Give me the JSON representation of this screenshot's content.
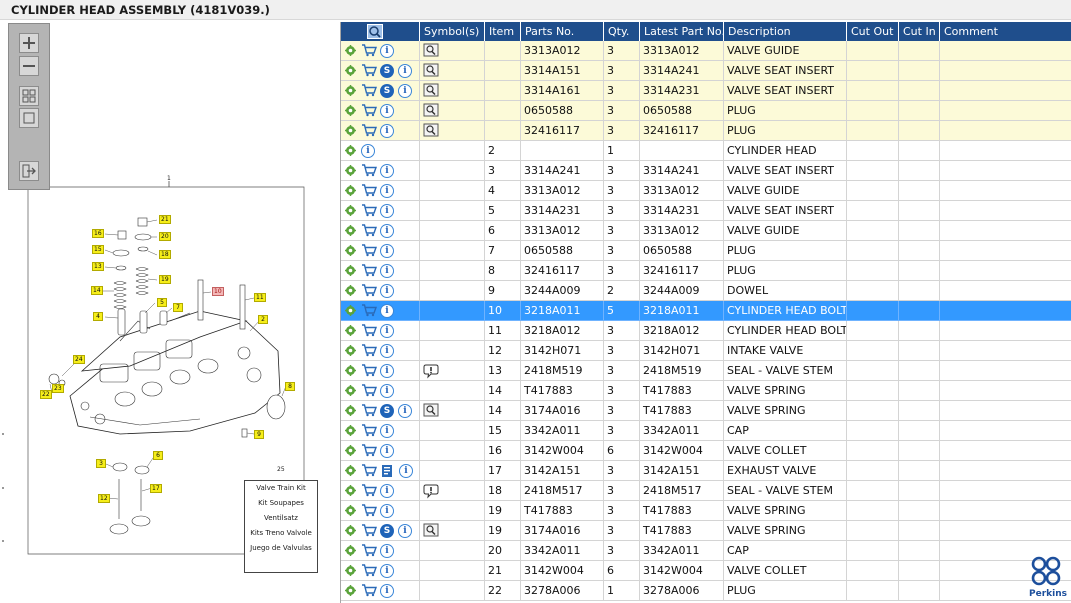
{
  "title": "CYLINDER HEAD ASSEMBLY (4181V039.)",
  "toolbar": {
    "buttons": [
      {
        "icon": "zoom-in-icon"
      },
      {
        "icon": "zoom-out-icon"
      },
      {
        "icon": "fit-all-icon"
      },
      {
        "icon": "fit-page-icon"
      },
      {
        "icon": "export-icon"
      }
    ]
  },
  "drawing": {
    "assembly_number": "1",
    "kit_number": "25",
    "kit_legend": [
      "Valve Train Kit",
      "Kit Soupapes",
      "Ventilsatz",
      "Kits Treno Valvole",
      "Juego de Valvulas"
    ],
    "callouts": [
      "21",
      "16",
      "20",
      "15",
      "18",
      "13",
      "19",
      "14",
      "5",
      "7",
      "10",
      "11",
      "4",
      "2",
      "24",
      "23",
      "22",
      "8",
      "9",
      "3",
      "6",
      "12",
      "17"
    ]
  },
  "columns": [
    "",
    "Symbol(s)",
    "Item",
    "Parts No.",
    "Qty.",
    "Latest Part No.",
    "Description",
    "Cut Out",
    "Cut In",
    "Comment"
  ],
  "rows": [
    {
      "kit": true,
      "sel": false,
      "cart": true,
      "s": false,
      "i": true,
      "sym": "book",
      "item": "",
      "part": "3313A012",
      "qty": "3",
      "latest": "3313A012",
      "desc": "VALVE GUIDE"
    },
    {
      "kit": true,
      "sel": false,
      "cart": true,
      "s": true,
      "i": true,
      "sym": "book",
      "item": "",
      "part": "3314A151",
      "qty": "3",
      "latest": "3314A241",
      "desc": "VALVE SEAT INSERT"
    },
    {
      "kit": true,
      "sel": false,
      "cart": true,
      "s": true,
      "i": true,
      "sym": "book",
      "item": "",
      "part": "3314A161",
      "qty": "3",
      "latest": "3314A231",
      "desc": "VALVE SEAT INSERT"
    },
    {
      "kit": true,
      "sel": false,
      "cart": true,
      "s": false,
      "i": true,
      "sym": "book",
      "item": "",
      "part": "0650588",
      "qty": "3",
      "latest": "0650588",
      "desc": "PLUG"
    },
    {
      "kit": true,
      "sel": false,
      "cart": true,
      "s": false,
      "i": true,
      "sym": "book",
      "item": "",
      "part": "32416117",
      "qty": "3",
      "latest": "32416117",
      "desc": "PLUG"
    },
    {
      "kit": false,
      "sel": false,
      "cart": false,
      "s": false,
      "i": true,
      "sym": "",
      "item": "2",
      "part": "",
      "qty": "1",
      "latest": "",
      "desc": "CYLINDER HEAD"
    },
    {
      "kit": false,
      "sel": false,
      "cart": true,
      "s": false,
      "i": true,
      "sym": "",
      "item": "3",
      "part": "3314A241",
      "qty": "3",
      "latest": "3314A241",
      "desc": "VALVE SEAT INSERT"
    },
    {
      "kit": false,
      "sel": false,
      "cart": true,
      "s": false,
      "i": true,
      "sym": "",
      "item": "4",
      "part": "3313A012",
      "qty": "3",
      "latest": "3313A012",
      "desc": "VALVE GUIDE"
    },
    {
      "kit": false,
      "sel": false,
      "cart": true,
      "s": false,
      "i": true,
      "sym": "",
      "item": "5",
      "part": "3314A231",
      "qty": "3",
      "latest": "3314A231",
      "desc": "VALVE SEAT INSERT"
    },
    {
      "kit": false,
      "sel": false,
      "cart": true,
      "s": false,
      "i": true,
      "sym": "",
      "item": "6",
      "part": "3313A012",
      "qty": "3",
      "latest": "3313A012",
      "desc": "VALVE GUIDE"
    },
    {
      "kit": false,
      "sel": false,
      "cart": true,
      "s": false,
      "i": true,
      "sym": "",
      "item": "7",
      "part": "0650588",
      "qty": "3",
      "latest": "0650588",
      "desc": "PLUG"
    },
    {
      "kit": false,
      "sel": false,
      "cart": true,
      "s": false,
      "i": true,
      "sym": "",
      "item": "8",
      "part": "32416117",
      "qty": "3",
      "latest": "32416117",
      "desc": "PLUG"
    },
    {
      "kit": false,
      "sel": false,
      "cart": true,
      "s": false,
      "i": true,
      "sym": "",
      "item": "9",
      "part": "3244A009",
      "qty": "2",
      "latest": "3244A009",
      "desc": "DOWEL"
    },
    {
      "kit": false,
      "sel": true,
      "cart": true,
      "s": false,
      "i": true,
      "sym": "",
      "item": "10",
      "part": "3218A011",
      "qty": "5",
      "latest": "3218A011",
      "desc": "CYLINDER HEAD BOLT"
    },
    {
      "kit": false,
      "sel": false,
      "cart": true,
      "s": false,
      "i": true,
      "sym": "",
      "item": "11",
      "part": "3218A012",
      "qty": "3",
      "latest": "3218A012",
      "desc": "CYLINDER HEAD BOLT"
    },
    {
      "kit": false,
      "sel": false,
      "cart": true,
      "s": false,
      "i": true,
      "sym": "",
      "item": "12",
      "part": "3142H071",
      "qty": "3",
      "latest": "3142H071",
      "desc": "INTAKE VALVE"
    },
    {
      "kit": false,
      "sel": false,
      "cart": true,
      "s": false,
      "i": true,
      "sym": "note",
      "item": "13",
      "part": "2418M519",
      "qty": "3",
      "latest": "2418M519",
      "desc": "SEAL - VALVE STEM"
    },
    {
      "kit": false,
      "sel": false,
      "cart": true,
      "s": false,
      "i": true,
      "sym": "",
      "item": "14",
      "part": "T417883",
      "qty": "3",
      "latest": "T417883",
      "desc": "VALVE SPRING"
    },
    {
      "kit": false,
      "sel": false,
      "cart": true,
      "s": true,
      "i": true,
      "sym": "book",
      "item": "14",
      "part": "3174A016",
      "qty": "3",
      "latest": "T417883",
      "desc": "VALVE SPRING"
    },
    {
      "kit": false,
      "sel": false,
      "cart": true,
      "s": false,
      "i": true,
      "sym": "",
      "item": "15",
      "part": "3342A011",
      "qty": "3",
      "latest": "3342A011",
      "desc": "CAP"
    },
    {
      "kit": false,
      "sel": false,
      "cart": true,
      "s": false,
      "i": true,
      "sym": "",
      "item": "16",
      "part": "3142W004",
      "qty": "6",
      "latest": "3142W004",
      "desc": "VALVE COLLET"
    },
    {
      "kit": false,
      "sel": false,
      "cart": true,
      "s": false,
      "i": true,
      "sym": "",
      "item": "17",
      "part": "3142A151",
      "qty": "3",
      "latest": "3142A151",
      "desc": "EXHAUST VALVE",
      "doc": true
    },
    {
      "kit": false,
      "sel": false,
      "cart": true,
      "s": false,
      "i": true,
      "sym": "note",
      "item": "18",
      "part": "2418M517",
      "qty": "3",
      "latest": "2418M517",
      "desc": "SEAL - VALVE STEM"
    },
    {
      "kit": false,
      "sel": false,
      "cart": true,
      "s": false,
      "i": true,
      "sym": "",
      "item": "19",
      "part": "T417883",
      "qty": "3",
      "latest": "T417883",
      "desc": "VALVE SPRING"
    },
    {
      "kit": false,
      "sel": false,
      "cart": true,
      "s": true,
      "i": true,
      "sym": "book",
      "item": "19",
      "part": "3174A016",
      "qty": "3",
      "latest": "T417883",
      "desc": "VALVE SPRING"
    },
    {
      "kit": false,
      "sel": false,
      "cart": true,
      "s": false,
      "i": true,
      "sym": "",
      "item": "20",
      "part": "3342A011",
      "qty": "3",
      "latest": "3342A011",
      "desc": "CAP"
    },
    {
      "kit": false,
      "sel": false,
      "cart": true,
      "s": false,
      "i": true,
      "sym": "",
      "item": "21",
      "part": "3142W004",
      "qty": "6",
      "latest": "3142W004",
      "desc": "VALVE COLLET"
    },
    {
      "kit": false,
      "sel": false,
      "cart": true,
      "s": false,
      "i": true,
      "sym": "",
      "item": "22",
      "part": "3278A006",
      "qty": "1",
      "latest": "3278A006",
      "desc": "PLUG"
    }
  ],
  "brand": {
    "name": "Perkins",
    "color": "#1d4f9c"
  },
  "colors": {
    "header": "#1f4e8c",
    "kit_row": "#fcfad8",
    "selected_row": "#3399ff",
    "callout": "#f6ee1a"
  }
}
